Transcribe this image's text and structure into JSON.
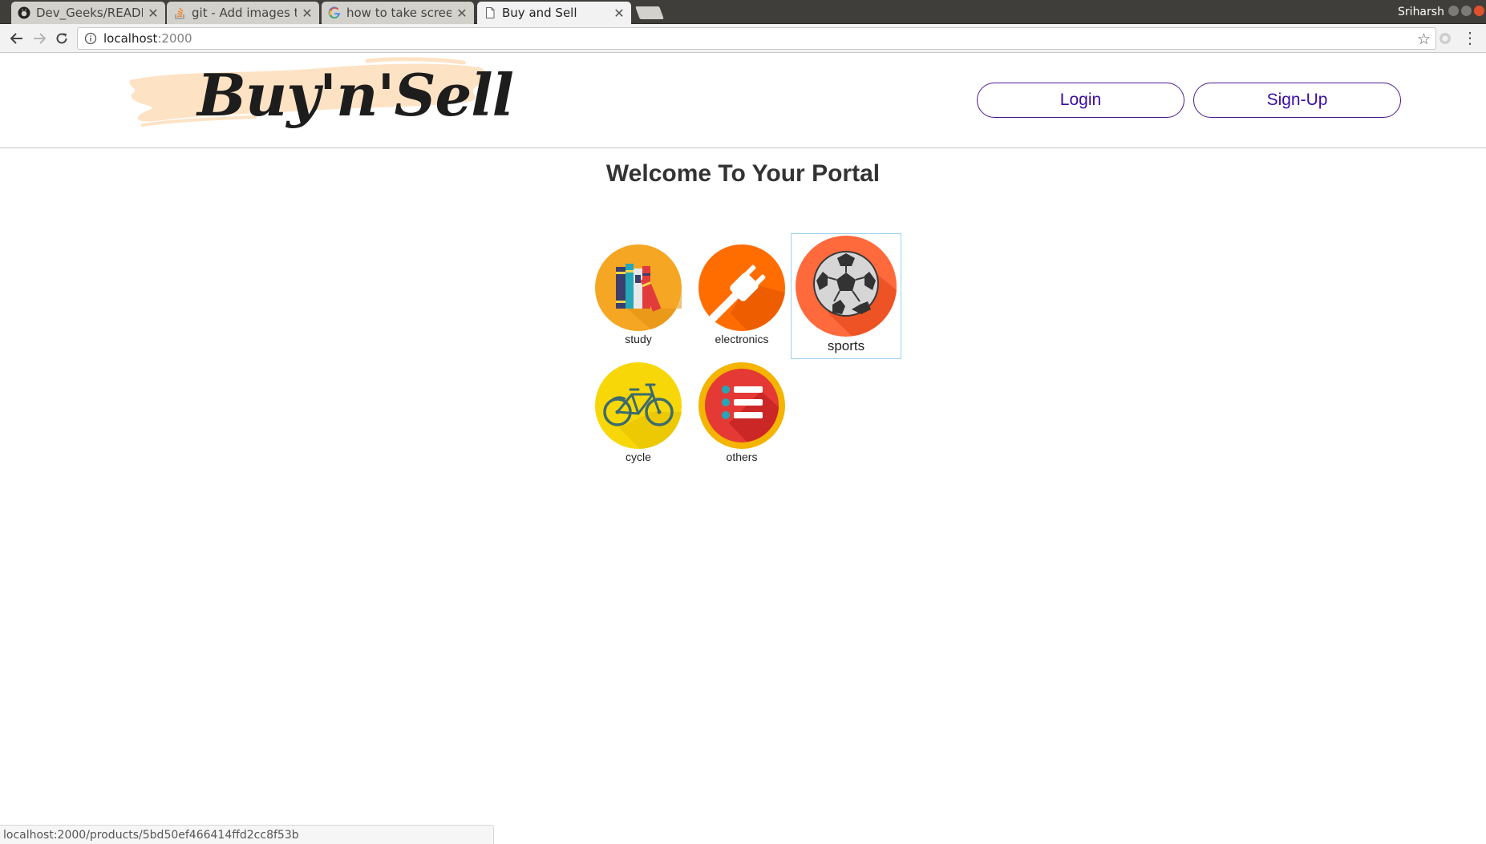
{
  "browser": {
    "tabs": [
      {
        "title": "Dev_Geeks/README",
        "icon": "github-icon",
        "active": false
      },
      {
        "title": "git - Add images to",
        "icon": "stackoverflow-icon",
        "active": false
      },
      {
        "title": "how to take screen",
        "icon": "google-icon",
        "active": false
      },
      {
        "title": "Buy and Sell",
        "icon": "page-icon",
        "active": true
      }
    ],
    "profile_name": "Sriharsh",
    "url_host": "localhost",
    "url_port": ":2000",
    "status_url": "localhost:2000/products/5bd50ef466414ffd2cc8f53b"
  },
  "header": {
    "logo_text": "Buy'n'Sell",
    "login_label": "Login",
    "signup_label": "Sign-Up"
  },
  "main": {
    "title": "Welcome To Your Portal",
    "categories": [
      {
        "label": "study",
        "icon": "books-icon",
        "color": "#f5a623"
      },
      {
        "label": "electronics",
        "icon": "plug-icon",
        "color": "#ff6d00"
      },
      {
        "label": "sports",
        "icon": "soccer-ball-icon",
        "color": "#ff6a3d",
        "selected": true
      },
      {
        "label": "cycle",
        "icon": "bicycle-icon",
        "color": "#f7d708"
      },
      {
        "label": "others",
        "icon": "list-icon",
        "color": "#e53935"
      }
    ]
  },
  "colors": {
    "accent": "#3a0ca3",
    "logo_brush": "#fde2c4",
    "selection_border": "#9bd3ee"
  }
}
